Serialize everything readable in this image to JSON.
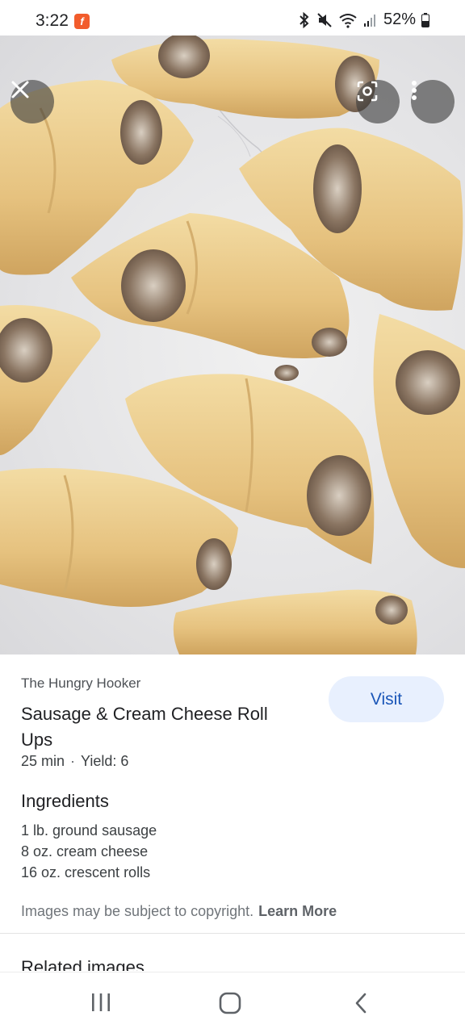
{
  "status_bar": {
    "time": "3:22",
    "app_badge": "f",
    "battery_percent": "52%",
    "icons": [
      "bluetooth-icon",
      "mute-icon",
      "wifi-icon",
      "signal-icon",
      "battery-icon"
    ]
  },
  "image_viewer": {
    "controls": [
      "close-icon",
      "lens-icon",
      "more-vert-icon"
    ]
  },
  "result": {
    "source": "The Hungry Hooker",
    "visit_label": "Visit",
    "title": "Sausage & Cream Cheese Roll Ups",
    "time": "25 min",
    "separator": "·",
    "yield": "Yield: 6",
    "ingredients_heading": "Ingredients",
    "ingredients": [
      "1 lb. ground sausage",
      "8 oz. cream cheese",
      "16 oz. crescent rolls"
    ],
    "copyright_text": "Images may be subject to copyright.",
    "learn_more": "Learn More",
    "related_heading": "Related images"
  },
  "nav_bar": {
    "items": [
      "recents-icon",
      "home-icon",
      "back-icon"
    ]
  },
  "colors": {
    "accent": "#1a56b8",
    "visit_bg": "#e8f0fe",
    "dough": "#e9c98a",
    "filling": "#7a6656"
  }
}
